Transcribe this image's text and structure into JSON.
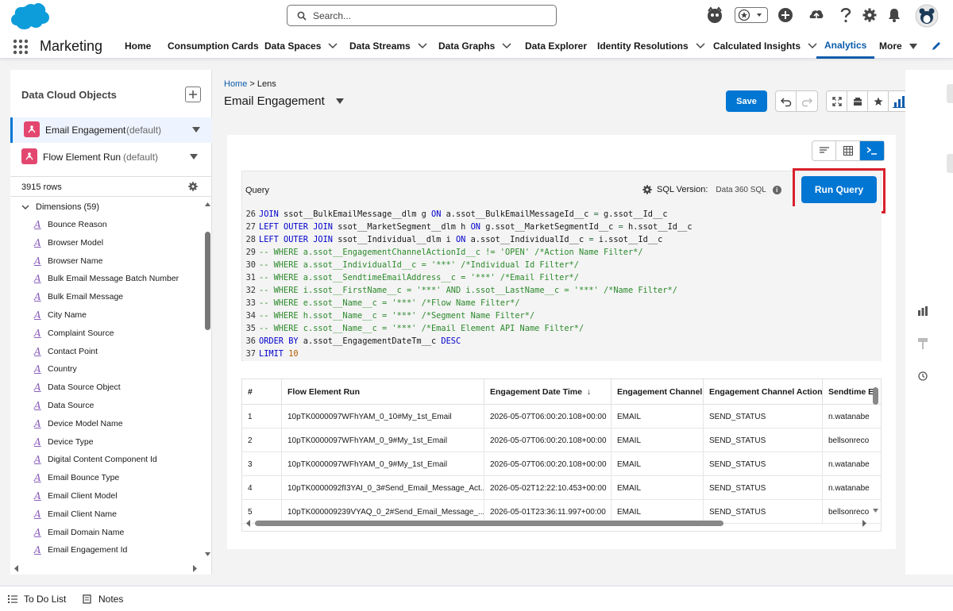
{
  "header": {
    "search_placeholder": "Search...",
    "icons": [
      "einstein-icon",
      "favorites-icon",
      "add-icon",
      "setup-assistant-icon",
      "help-icon",
      "gear-icon",
      "notifications-icon",
      "avatar"
    ]
  },
  "appnav": {
    "app_name": "Marketing",
    "items": [
      {
        "label": "Home"
      },
      {
        "label": "Consumption Cards"
      },
      {
        "label": "Data Spaces"
      },
      {
        "label": "Data Streams"
      },
      {
        "label": "Data Graphs"
      },
      {
        "label": "Data Explorer"
      },
      {
        "label": "Identity Resolutions"
      },
      {
        "label": "Calculated Insights"
      },
      {
        "label": "Analytics"
      },
      {
        "label": "More"
      }
    ],
    "active": "Analytics"
  },
  "leftpanel": {
    "title": "Data Cloud Objects",
    "objects": [
      {
        "name": "Email Engagement",
        "tag": "(default)"
      },
      {
        "name": "Flow Element Run",
        "tag": "(default)"
      }
    ],
    "row_count": "3915 rows",
    "dimensions_label": "Dimensions (59)",
    "fields": [
      "Bounce Reason",
      "Browser Model",
      "Browser Name",
      "Bulk Email Message Batch Number",
      "Bulk Email Message",
      "City Name",
      "Complaint Source",
      "Contact Point",
      "Country",
      "Data Source Object",
      "Data Source",
      "Device Model Name",
      "Device Type",
      "Digital Content Component Id",
      "Email Bounce Type",
      "Email Client Model",
      "Email Client Name",
      "Email Domain Name",
      "Email Engagement Id"
    ]
  },
  "main": {
    "breadcrumb_home": "Home",
    "breadcrumb_sep": ">",
    "breadcrumb_current": "Lens",
    "title": "Email Engagement",
    "save_label": "Save",
    "query_label": "Query",
    "sql_version_label": "SQL Version:",
    "sql_version_value": "Data 360 SQL",
    "run_query_label": "Run Query",
    "highlight_color": "#d8212c"
  },
  "code_lines": [
    {
      "n": "26",
      "tokens": [
        [
          "kw",
          "JOIN"
        ],
        [
          "id",
          " ssot__BulkEmailMessage__dlm g "
        ],
        [
          "kw",
          "ON"
        ],
        [
          "id",
          " a.ssot__BulkEmailMessageId__c "
        ],
        [
          "op",
          "="
        ],
        [
          "id",
          " g.ssot__Id__c"
        ]
      ]
    },
    {
      "n": "27",
      "tokens": [
        [
          "kw",
          "LEFT OUTER JOIN"
        ],
        [
          "id",
          " ssot__MarketSegment__dlm h "
        ],
        [
          "kw",
          "ON"
        ],
        [
          "id",
          " g.ssot__MarketSegmentId__c "
        ],
        [
          "op",
          "="
        ],
        [
          "id",
          " h.ssot__Id__c"
        ]
      ]
    },
    {
      "n": "28",
      "tokens": [
        [
          "kw",
          "LEFT OUTER JOIN"
        ],
        [
          "id",
          " ssot__Individual__dlm i "
        ],
        [
          "kw",
          "ON"
        ],
        [
          "id",
          " a.ssot__IndividualId__c "
        ],
        [
          "op",
          "="
        ],
        [
          "id",
          " i.ssot__Id__c"
        ]
      ]
    },
    {
      "n": "29",
      "tokens": [
        [
          "cm",
          "-- WHERE a.ssot__EngagementChannelActionId__c != 'OPEN' /*Action Name Filter*/"
        ]
      ]
    },
    {
      "n": "30",
      "tokens": [
        [
          "cm",
          "-- WHERE a.ssot__IndividualId__c = '***' /*Individual Id Filter*/"
        ]
      ]
    },
    {
      "n": "31",
      "tokens": [
        [
          "cm",
          "-- WHERE a.ssot__SendtimeEmailAddress__c = '***' /*Email Filter*/"
        ]
      ]
    },
    {
      "n": "32",
      "tokens": [
        [
          "cm",
          "-- WHERE i.ssot__FirstName__c = '***' AND i.ssot__LastName__c = '***' /*Name Filter*/"
        ]
      ]
    },
    {
      "n": "33",
      "tokens": [
        [
          "cm",
          "-- WHERE e.ssot__Name__c = '***' /*Flow Name Filter*/"
        ]
      ]
    },
    {
      "n": "34",
      "tokens": [
        [
          "cm",
          "-- WHERE h.ssot__Name__c = '***' /*Segment Name Filter*/"
        ]
      ]
    },
    {
      "n": "35",
      "tokens": [
        [
          "cm",
          "-- WHERE c.ssot__Name__c = '***' /*Email Element API Name Filter*/"
        ]
      ]
    },
    {
      "n": "36",
      "tokens": [
        [
          "kw",
          "ORDER BY"
        ],
        [
          "id",
          " a.ssot__EngagementDateTm__c "
        ],
        [
          "kw",
          "DESC"
        ]
      ]
    },
    {
      "n": "37",
      "tokens": [
        [
          "kw",
          "LIMIT"
        ],
        [
          "id",
          " "
        ],
        [
          "nm",
          "10"
        ]
      ]
    }
  ],
  "table": {
    "columns": [
      "#",
      "Flow Element Run",
      "Engagement Date Time",
      "Engagement Channel",
      "Engagement Channel Action",
      "Sendtime E"
    ],
    "sort_indicator": "↓",
    "rows": [
      [
        "1",
        "10pTK0000097WFhYAM_0_10#My_1st_Email",
        "2026-05-07T06:00:20.108+00:00",
        "EMAIL",
        "SEND_STATUS",
        "n.watanabe"
      ],
      [
        "2",
        "10pTK0000097WFhYAM_0_9#My_1st_Email",
        "2026-05-07T06:00:20.108+00:00",
        "EMAIL",
        "SEND_STATUS",
        "bellsonreco"
      ],
      [
        "3",
        "10pTK0000097WFhYAM_0_9#My_1st_Email",
        "2026-05-07T06:00:20.108+00:00",
        "EMAIL",
        "SEND_STATUS",
        "n.watanabe"
      ],
      [
        "4",
        "10pTK0000092fI3YAI_0_3#Send_Email_Message_Act...",
        "2026-05-02T12:22:10.453+00:00",
        "EMAIL",
        "SEND_STATUS",
        "n.watanabe"
      ],
      [
        "5",
        "10pTK000009239VYAQ_0_2#Send_Email_Message_...",
        "2026-05-01T23:36:11.997+00:00",
        "EMAIL",
        "SEND_STATUS",
        "bellsonreco"
      ]
    ]
  },
  "footer": {
    "todo_label": "To Do List",
    "notes_label": "Notes"
  }
}
